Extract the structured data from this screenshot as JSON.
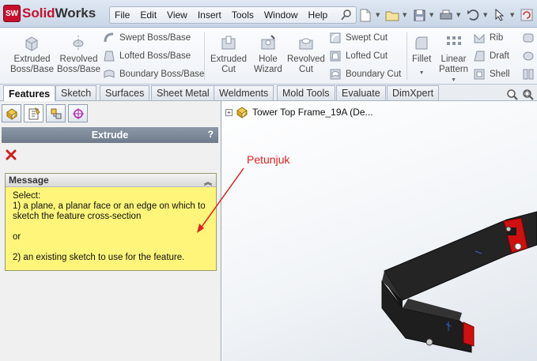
{
  "app": {
    "logo_badge": "SW",
    "logo_solid": "Solid",
    "logo_works": "Works"
  },
  "menu": [
    "File",
    "Edit",
    "View",
    "Insert",
    "Tools",
    "Window",
    "Help"
  ],
  "ribbon": {
    "extruded_boss": [
      "Extruded",
      "Boss/Base"
    ],
    "revolved_boss": [
      "Revolved",
      "Boss/Base"
    ],
    "swept_boss": "Swept Boss/Base",
    "lofted_boss": "Lofted Boss/Base",
    "boundary_boss": "Boundary Boss/Base",
    "extruded_cut": [
      "Extruded",
      "Cut"
    ],
    "hole_wizard": [
      "Hole",
      "Wizard"
    ],
    "revolved_cut": [
      "Revolved",
      "Cut"
    ],
    "swept_cut": "Swept Cut",
    "lofted_cut": "Lofted Cut",
    "boundary_cut": "Boundary Cut",
    "fillet": "Fillet",
    "linear_pattern": [
      "Linear",
      "Pattern"
    ],
    "rib": "Rib",
    "draft": "Draft",
    "shell": "Shell"
  },
  "tabs": [
    "Features",
    "Sketch",
    "Surfaces",
    "Sheet Metal",
    "Weldments",
    "Mold Tools",
    "Evaluate",
    "DimXpert"
  ],
  "property_manager": {
    "title": "Extrude",
    "help": "?",
    "message_title": "Message",
    "message_lines": [
      "Select:",
      "1) a plane, a planar face or an edge on which to",
      "sketch the feature cross-section",
      "",
      "or",
      "",
      "2) an existing sketch to use for the feature."
    ]
  },
  "tree": {
    "root_label": "Tower Top Frame_19A  (De..."
  },
  "annotation": {
    "text": "Petunjuk",
    "color": "#e02020"
  },
  "colors": {
    "accent_red": "#c8102e",
    "message_bg": "#fff57a",
    "model_body": "#1b1b1b",
    "model_red": "#d01010"
  }
}
